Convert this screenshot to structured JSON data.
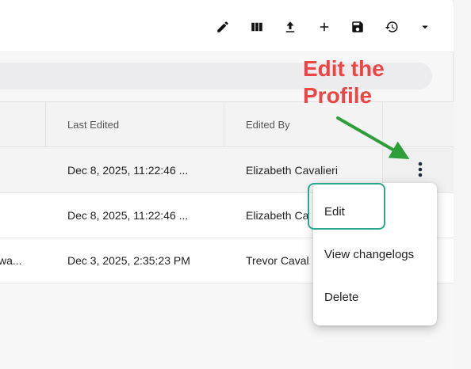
{
  "toolbar": {
    "icons": [
      "edit-pencil-icon",
      "columns-icon",
      "upload-icon",
      "plus-icon",
      "save-icon",
      "history-icon",
      "caret-down-icon"
    ]
  },
  "table": {
    "columns": [
      "Last Edited",
      "Edited By"
    ],
    "rows": [
      {
        "name_fragment": "",
        "last_edited": "Dec 8, 2025, 11:22:46 ...",
        "edited_by": "Elizabeth Cavalieri"
      },
      {
        "name_fragment": "",
        "last_edited": "Dec 8, 2025, 11:22:46 ...",
        "edited_by": "Elizabeth Ca"
      },
      {
        "name_fragment": "wa...",
        "last_edited": "Dec 3, 2025, 2:35:23 PM",
        "edited_by": "Trevor Caval"
      }
    ]
  },
  "menu": {
    "items": [
      "Edit",
      "View changelogs",
      "Delete"
    ]
  },
  "annotation": {
    "line1": "Edit the",
    "line2": "Profile",
    "color": "#ef4444",
    "arrow_color": "#2e9e3a",
    "highlight_color": "#2aa88e"
  }
}
